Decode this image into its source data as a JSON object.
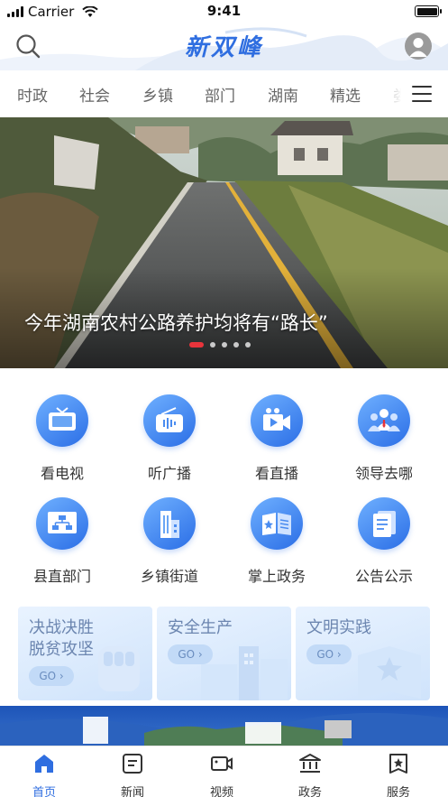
{
  "status_bar": {
    "carrier": "Carrier",
    "time": "9:41"
  },
  "header": {
    "logo_text": "新双峰",
    "search_icon": "search-icon",
    "avatar_icon": "user-avatar-icon"
  },
  "tabs": {
    "items": [
      {
        "label": "时政"
      },
      {
        "label": "社会"
      },
      {
        "label": "乡镇"
      },
      {
        "label": "部门"
      },
      {
        "label": "湖南"
      },
      {
        "label": "精选"
      },
      {
        "label": "娄"
      }
    ],
    "menu_icon": "hamburger-menu-icon"
  },
  "banner": {
    "caption": "今年湖南农村公路养护均将有“路长”",
    "slide_count": 5,
    "active_slide": 1
  },
  "services": [
    {
      "label": "看电视",
      "icon": "tv-icon"
    },
    {
      "label": "听广播",
      "icon": "radio-icon"
    },
    {
      "label": "看直播",
      "icon": "live-video-icon"
    },
    {
      "label": "领导去哪",
      "icon": "leaders-icon"
    },
    {
      "label": "县直部门",
      "icon": "org-chart-icon"
    },
    {
      "label": "乡镇街道",
      "icon": "buildings-icon"
    },
    {
      "label": "掌上政务",
      "icon": "open-book-icon"
    },
    {
      "label": "公告公示",
      "icon": "document-icon"
    }
  ],
  "cards": [
    {
      "title": "决战决胜\n脱贫攻坚",
      "go": "GO"
    },
    {
      "title": "安全生产",
      "go": "GO"
    },
    {
      "title": "文明实践",
      "go": "GO"
    }
  ],
  "bottom_nav": [
    {
      "label": "首页",
      "icon": "home-icon",
      "active": true
    },
    {
      "label": "新闻",
      "icon": "news-icon",
      "active": false
    },
    {
      "label": "视频",
      "icon": "video-camera-icon",
      "active": false
    },
    {
      "label": "政务",
      "icon": "government-icon",
      "active": false
    },
    {
      "label": "服务",
      "icon": "service-star-icon",
      "active": false
    }
  ],
  "colors": {
    "accent": "#2f6ee0",
    "active_dot": "#e8343b",
    "card_text": "#6c86b0"
  }
}
